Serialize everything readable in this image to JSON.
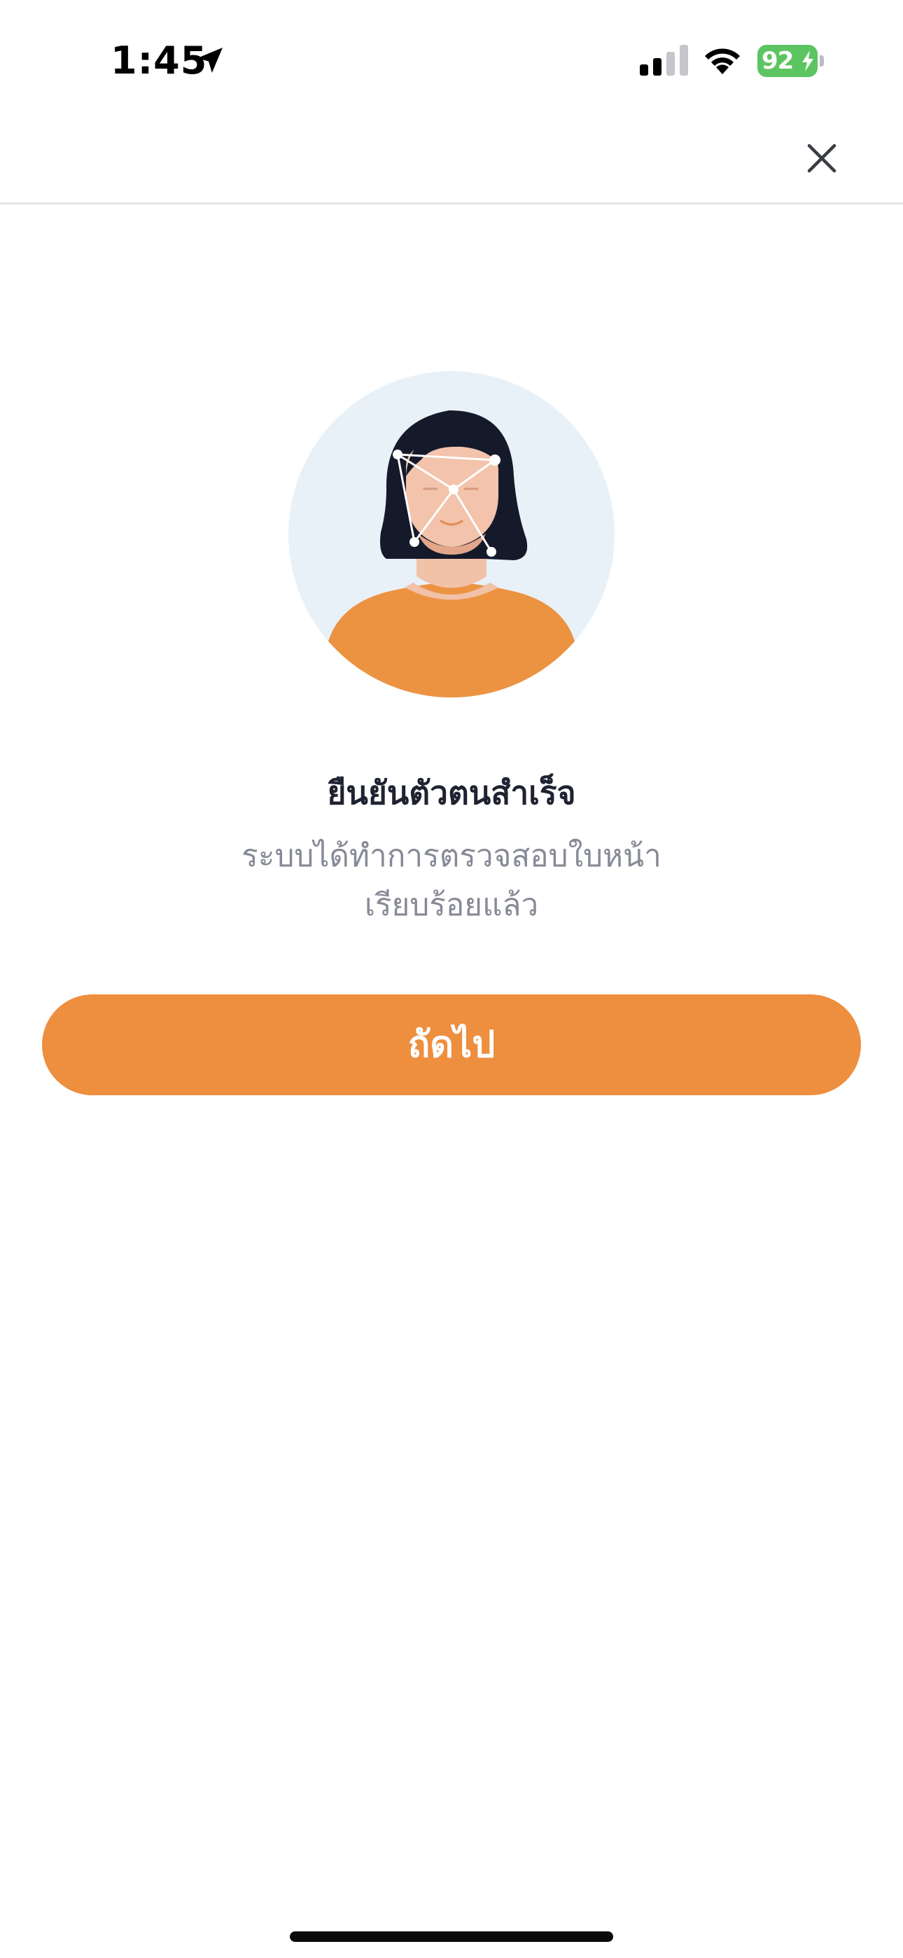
{
  "status_bar": {
    "time": "1:45",
    "battery_level": "92",
    "battery_color": "#5cc461",
    "icons": [
      "location-arrow-icon",
      "cellular-signal-icon",
      "wifi-icon",
      "battery-charging-icon"
    ]
  },
  "header": {
    "close_icon": "close-icon"
  },
  "content": {
    "illustration": "face-scan-illustration",
    "title": "ยืนยันตัวตนสำเร็จ",
    "description_lines": [
      "ระบบได้ทำการตรวจสอบใบหน้า",
      "เรียบร้อยแล้ว"
    ]
  },
  "actions": {
    "next_label": "ถัดไป",
    "accent_color": "#ee8e3f"
  }
}
